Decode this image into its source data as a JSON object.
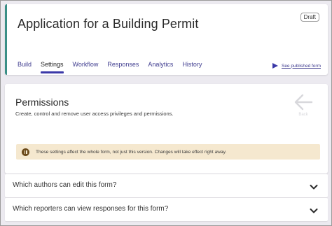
{
  "header": {
    "title": "Application for a Building Permit",
    "status_badge": "Draft",
    "tabs": [
      {
        "label": "Build",
        "active": false
      },
      {
        "label": "Settings",
        "active": true
      },
      {
        "label": "Workflow",
        "active": false
      },
      {
        "label": "Responses",
        "active": false
      },
      {
        "label": "Analytics",
        "active": false
      },
      {
        "label": "History",
        "active": false
      }
    ],
    "published_link": "See published form",
    "published_icon": "play-icon"
  },
  "permissions": {
    "title": "Permissions",
    "description": "Create, control and remove user access privileges and permissions.",
    "back_label": "Back",
    "back_icon": "arrow-left-icon",
    "notice": {
      "icon": "pause-icon",
      "text": "These settings affect the whole form, not just this version. Changes will take effect right away."
    }
  },
  "accordion": [
    {
      "label": "Which authors can edit this form?",
      "icon": "chevron-down-icon"
    },
    {
      "label": "Which reporters can view responses for this form?",
      "icon": "chevron-down-icon"
    }
  ],
  "colors": {
    "accent": "#3b39a8",
    "link": "#3f3c8f",
    "header_border": "#3a8f86",
    "notice_bg": "#f5e8cf",
    "notice_icon": "#6b4a1a",
    "page_bg": "#eceaf0"
  }
}
